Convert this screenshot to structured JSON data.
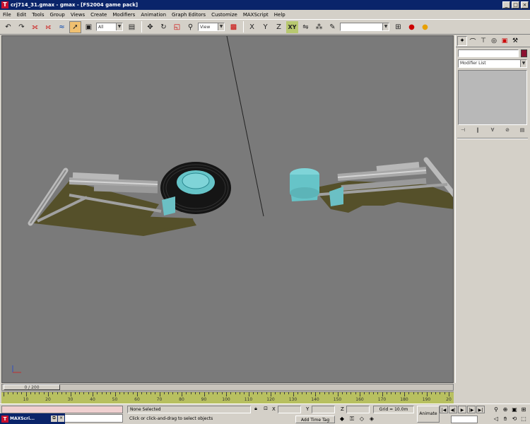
{
  "window": {
    "title": "crj714_31.gmax - gmax - [FS2004 game pack]",
    "min": "_",
    "max": "□",
    "close": "×"
  },
  "menu": [
    "File",
    "Edit",
    "Tools",
    "Group",
    "Views",
    "Create",
    "Modifiers",
    "Animation",
    "Graph Editors",
    "Customize",
    "MAXScript",
    "Help"
  ],
  "toolbar": {
    "selection_filter": "All",
    "reference_coord": "View",
    "named_selection": "",
    "xy_constraint": "XY",
    "x_constraint": "X",
    "y_constraint": "Y",
    "z_constraint": "Z"
  },
  "command_panel": {
    "modifier_list": "Modifier List"
  },
  "timeline": {
    "frame_readout": "0 / 200",
    "ruler_labels": [
      "10",
      "20",
      "30",
      "40",
      "50",
      "60",
      "70",
      "80",
      "90",
      "100",
      "110",
      "120",
      "130",
      "140",
      "150",
      "160",
      "170",
      "180",
      "190",
      "20"
    ]
  },
  "status": {
    "selection": "None Selected",
    "prompt": "Click or click-and-drag to select objects",
    "x_label": "X",
    "y_label": "Y",
    "z_label": "Z",
    "grid": "Grid = 10.0m",
    "add_time_tag": "Add Time Tag",
    "animate": "Animate"
  },
  "taskbar": {
    "label": "MAXScri..."
  },
  "colors": {
    "viewport_bg": "#7a7a7a",
    "object_color": "#8b1030",
    "ruler": "#b8c060",
    "ground_patch": "#55502a",
    "wheel_hub": "#66c4c8"
  }
}
